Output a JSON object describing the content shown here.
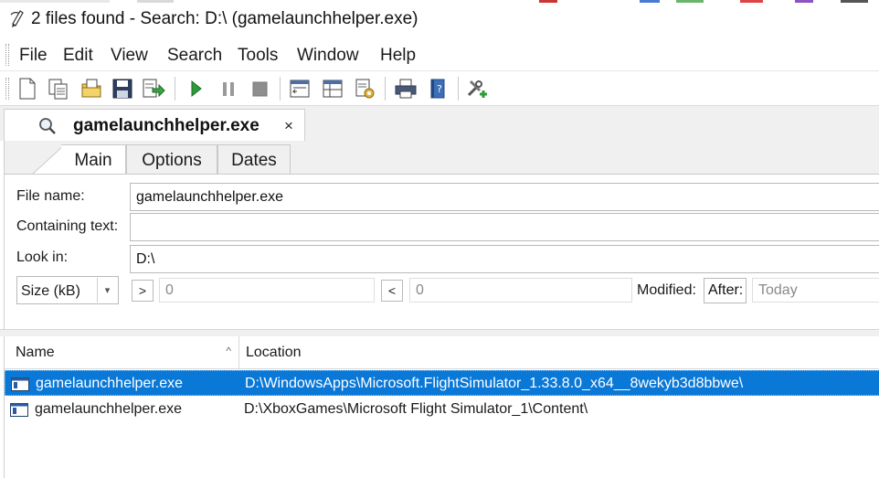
{
  "window": {
    "title": "2 files found - Search: D:\\ (gamelaunchhelper.exe)"
  },
  "menu": [
    "File",
    "Edit",
    "View",
    "Search",
    "Tools",
    "Window",
    "Help"
  ],
  "toolbar": {
    "icons": [
      "new-file-icon",
      "copy-document-icon",
      "open-folder-icon",
      "save-icon",
      "export-icon",
      "play-icon",
      "pause-icon",
      "stop-icon",
      "results-window-icon",
      "split-view-icon",
      "settings-document-icon",
      "print-icon",
      "help-book-icon",
      "tools-add-icon"
    ]
  },
  "document_tab": {
    "title": "gamelaunchhelper.exe",
    "close": "×"
  },
  "subtabs": [
    "Main",
    "Options",
    "Dates"
  ],
  "form": {
    "file_name_label": "File name:",
    "file_name_value": "gamelaunchhelper.exe",
    "containing_text_label": "Containing text:",
    "containing_text_value": "",
    "look_in_label": "Look in:",
    "look_in_value": "D:\\",
    "size_unit": "Size (kB)",
    "greater_than": ">",
    "min_size": "0",
    "less_than": "<",
    "max_size": "0",
    "modified_label": "Modified:",
    "after_label": "After:",
    "date_value": "Today"
  },
  "results": {
    "columns": {
      "name": "Name",
      "location": "Location"
    },
    "rows": [
      {
        "name": "gamelaunchhelper.exe",
        "location": "D:\\WindowsApps\\Microsoft.FlightSimulator_1.33.8.0_x64__8wekyb3d8bbwe\\",
        "selected": true
      },
      {
        "name": "gamelaunchhelper.exe",
        "location": "D:\\XboxGames\\Microsoft Flight Simulator_1\\Content\\",
        "selected": false
      }
    ]
  },
  "colors": {
    "selection": "#0a78d7",
    "panel_bg": "#f0f0f0"
  }
}
